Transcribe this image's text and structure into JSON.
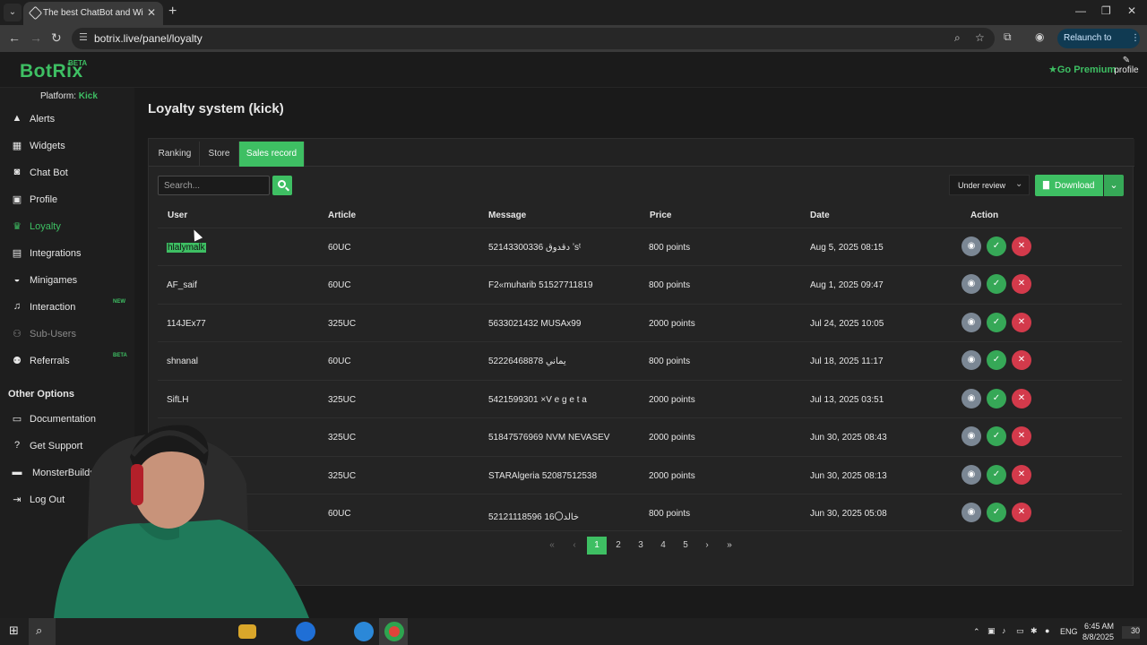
{
  "browser": {
    "tab_title": "The best ChatBot and Widgets f",
    "url": "botrix.live/panel/loyalty",
    "relaunch_label": "Relaunch to update"
  },
  "app": {
    "logo": "BotRix",
    "logo_badge": "BETA",
    "go_premium": "Go Premium",
    "profile_label": "profile",
    "accent_color": "#3ebf63"
  },
  "sidebar": {
    "platform_label": "Platform:",
    "platform_value": "Kick",
    "items": [
      {
        "label": "Alerts",
        "icon": "warning-icon"
      },
      {
        "label": "Widgets",
        "icon": "widgets-icon"
      },
      {
        "label": "Chat Bot",
        "icon": "robot-icon"
      },
      {
        "label": "Profile",
        "icon": "profile-card-icon"
      },
      {
        "label": "Loyalty",
        "icon": "trophy-icon"
      },
      {
        "label": "Integrations",
        "icon": "integrations-icon"
      },
      {
        "label": "Minigames",
        "icon": "gamepad-icon"
      },
      {
        "label": "Interaction",
        "icon": "music-icon",
        "badge": "NEW"
      },
      {
        "label": "Sub-Users",
        "icon": "sub-users-icon"
      },
      {
        "label": "Referrals",
        "icon": "referrals-icon",
        "badge": "BETA"
      }
    ],
    "other_heading": "Other Options",
    "other_items": [
      {
        "label": "Documentation",
        "icon": "document-icon"
      },
      {
        "label": "Get Support",
        "icon": "question-icon"
      },
      {
        "label": "MonsterBuilds",
        "icon": "monitor-icon"
      },
      {
        "label": "Log Out",
        "icon": "logout-icon"
      }
    ]
  },
  "main": {
    "title": "Loyalty system (kick)",
    "tabs": [
      "Ranking",
      "Store",
      "Sales record"
    ],
    "active_tab": "Sales record",
    "search_placeholder": "Search...",
    "status_filter": "Under review",
    "download_label": "Download",
    "columns": [
      "User",
      "Article",
      "Message",
      "Price",
      "Date",
      "Action"
    ],
    "rows": [
      {
        "user": "hlalymalk",
        "article": "60UC",
        "message": "52143300336 دقدوق ʼsᵗ",
        "price": "800 points",
        "date": "Aug 5, 2025 08:15"
      },
      {
        "user": "AF_saif",
        "article": "60UC",
        "message": "F2«muharib 51527711819",
        "price": "800 points",
        "date": "Aug 1, 2025 09:47"
      },
      {
        "user": "114JEx77",
        "article": "325UC",
        "message": "5633021432 MUSAx99",
        "price": "2000 points",
        "date": "Jul 24, 2025 10:05"
      },
      {
        "user": "shnanal",
        "article": "60UC",
        "message": "52226468878 يماني",
        "price": "800 points",
        "date": "Jul 18, 2025 11:17"
      },
      {
        "user": "SifLH",
        "article": "325UC",
        "message": "5421599301 ×V e g e t a",
        "price": "2000 points",
        "date": "Jul 13, 2025 03:51"
      },
      {
        "user": "",
        "article": "325UC",
        "message": "51847576969 NVM NEVASEV",
        "price": "2000 points",
        "date": "Jun 30, 2025 08:43"
      },
      {
        "user": "",
        "article": "325UC",
        "message": "STARAlgeria 52087512538",
        "price": "2000 points",
        "date": "Jun 30, 2025 08:13"
      },
      {
        "user": "",
        "article": "60UC",
        "message": "52121118596 16〇خالد",
        "price": "800 points",
        "date": "Jun 30, 2025 05:08"
      }
    ],
    "pagination": {
      "first": "«",
      "prev": "‹",
      "pages": [
        "1",
        "2",
        "3",
        "4",
        "5"
      ],
      "current": "1",
      "next": "›",
      "last": "»"
    }
  },
  "taskbar": {
    "language": "ENG",
    "time": "6:45 AM",
    "date": "8/8/2025",
    "notifications": "30"
  }
}
